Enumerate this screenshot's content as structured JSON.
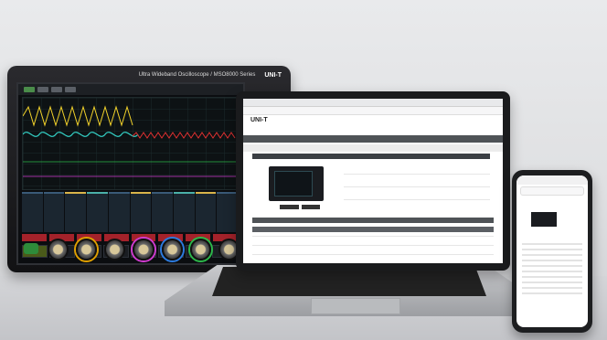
{
  "scope": {
    "brand": "UNI-T",
    "header_text": "Ultra Wideband Oscilloscope / MSO8000 Series"
  },
  "laptop": {
    "site_brand": "UNI-T"
  },
  "colors": {
    "yellow_trace": "#f1d12a",
    "cyan_trace": "#34d2c7",
    "red_trace": "#e03131",
    "magenta_trace": "#d03bd0"
  }
}
